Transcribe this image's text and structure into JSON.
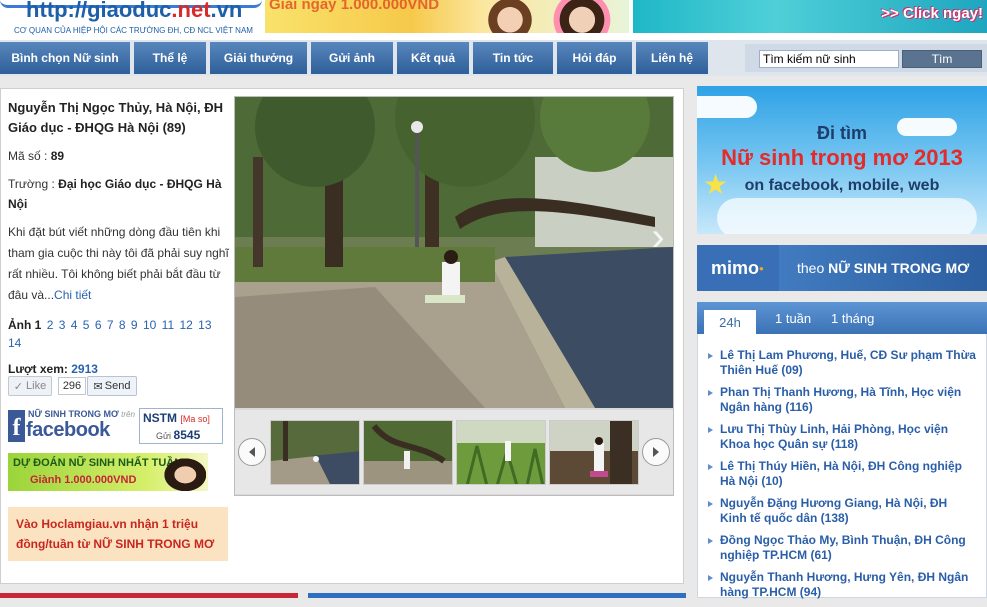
{
  "header": {
    "logo_text_prefix": "http://giaoduc",
    "logo_text_net": ".net",
    "logo_text_suffix": ".vn",
    "logo_subtitle": "CƠ QUAN CỦA HIỆP HỘI CÁC TRƯỜNG ĐH, CĐ NCL VIỆT NAM",
    "top_banner_text": "Giải ngay 1.000.000VND",
    "click_banner_text": ">> Click ngay!"
  },
  "nav": {
    "items": [
      {
        "label": "Bình chọn Nữ sinh"
      },
      {
        "label": "Thể lệ"
      },
      {
        "label": "Giải thưởng"
      },
      {
        "label": "Gửi ảnh"
      },
      {
        "label": "Kết quả"
      },
      {
        "label": "Tin tức"
      },
      {
        "label": "Hỏi đáp"
      },
      {
        "label": "Liên hệ"
      }
    ],
    "search_value": "Tìm kiếm nữ sinh",
    "search_button": "Tìm"
  },
  "contestant": {
    "title": "Nguyễn Thị Ngọc Thủy, Hà Nội, ĐH Giáo dục - ĐHQG Hà Nội (89)",
    "id_label": "Mã số :",
    "id_value": "89",
    "school_label": "Trường :",
    "school_value": "Đại học Giáo dục - ĐHQG Hà Nội",
    "description": "Khi đặt bút viết những dòng đầu tiên khi tham gia cuộc thi này tôi đã phải suy nghĩ rất nhiều. Tôi không biết phải bắt đầu từ đâu và...",
    "more_link": "Chi tiết",
    "photos_label": "Ảnh",
    "photo_numbers": [
      "1",
      "2",
      "3",
      "4",
      "5",
      "6",
      "7",
      "8",
      "9",
      "10",
      "11",
      "12",
      "13",
      "14"
    ],
    "views_label": "Lượt xem:",
    "views_value": "2913"
  },
  "social": {
    "like_label": "Like",
    "like_count": "296",
    "send_label": "Send"
  },
  "banners": {
    "fb_small": "NỮ SINH TRONG MƠ",
    "fb_small_suffix": "trên",
    "fb_word": "facebook",
    "sms_code": "NSTM",
    "sms_hint": "[Ma so]",
    "sms_send": "Gửi",
    "sms_number": "8545",
    "predict_line1": "DỰ ĐOÁN NỮ SINH NHẤT TUẦN",
    "predict_line2": "Giành 1.000.000VND",
    "promo_text": "Vào Hoclamgiau.vn nhận 1 triệu đồng/tuần từ NỮ SINH TRONG MƠ"
  },
  "right": {
    "promo_l1": "Đi tìm",
    "promo_l2": "Nữ sinh trong mơ 2013",
    "promo_l3": "on facebook, mobile, web",
    "mimo_logo": "mimo",
    "mimo_text_prefix": "theo",
    "mimo_text_bold": "NỮ SINH TRONG MƠ",
    "tabs": [
      {
        "label": "24h"
      },
      {
        "label": "1 tuần"
      },
      {
        "label": "1 tháng"
      }
    ],
    "list": [
      "Lê Thị Lam Phương, Huế, CĐ Sư phạm Thừa Thiên Huế (09)",
      "Phan Thị Thanh Hương, Hà Tĩnh, Học viện Ngân hàng (116)",
      "Lưu Thị Thùy Linh, Hải Phòng, Học viện Khoa học Quân sự (118)",
      "Lê Thị Thúy Hiền, Hà Nội, ĐH Công nghiệp Hà Nội (10)",
      "Nguyễn Đặng Hương Giang, Hà Nội, ĐH Kinh tế quốc dân (138)",
      "Đồng Ngọc Thảo My, Bình Thuận, ĐH Công nghiệp TP.HCM (61)",
      "Nguyễn Thanh Hương, Hưng Yên, ĐH Ngân hàng TP.HCM (94)"
    ]
  },
  "colors": {
    "nav_blue": "#3a6ca8",
    "link_blue": "#2a62b0",
    "promo_red": "#c8261f"
  }
}
